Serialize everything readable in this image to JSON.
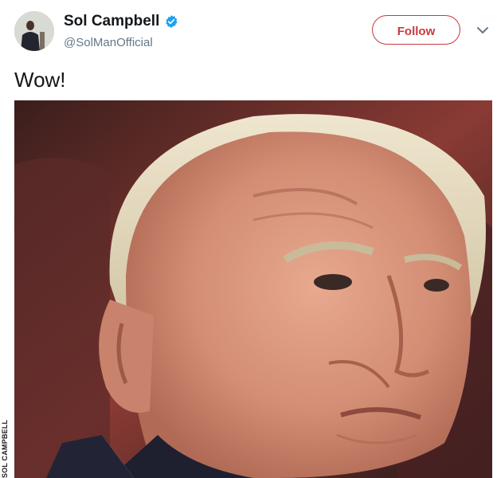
{
  "tweet": {
    "author": {
      "display_name": "Sol Campbell",
      "handle": "@SolManOfficial",
      "verified": true,
      "avatar_icon": "profile-photo"
    },
    "follow_label": "Follow",
    "menu_icon": "chevron-down-icon",
    "text": "Wow!",
    "media": {
      "description_icon": "photo"
    }
  },
  "credit": "SOL CAMPBELL",
  "colors": {
    "follow_accent": "#c8393f",
    "verified_blue": "#1da1f2",
    "handle_gray": "#657786",
    "text_dark": "#14171a"
  }
}
